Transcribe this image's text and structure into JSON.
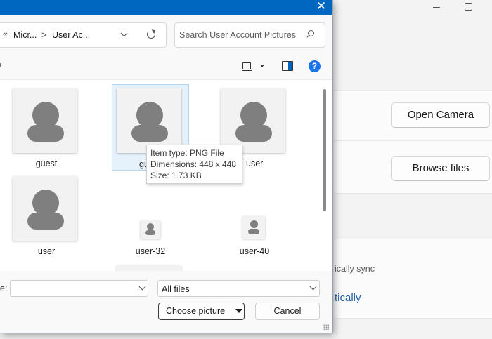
{
  "background": {
    "open_camera": "Open Camera",
    "browse_files": "Browse files",
    "sync_text": "ically sync",
    "auto_text": "tically"
  },
  "dialog": {
    "breadcrumb": {
      "back": "«",
      "part1": "Micr...",
      "sep": ">",
      "part2": "User Ac..."
    },
    "search": {
      "placeholder": "Search User Account Pictures"
    },
    "files": [
      {
        "name": "guest"
      },
      {
        "name": "gu"
      },
      {
        "name": "user"
      },
      {
        "name": "user"
      },
      {
        "name": "user-32"
      },
      {
        "name": "user-40"
      }
    ],
    "tooltip": {
      "type": "Item type: PNG File",
      "dimensions": "Dimensions: 448 x 448",
      "size": "Size: 1.73 KB"
    },
    "file_name_label": "e:",
    "file_name_value": "",
    "file_type": "All files",
    "choose_button": "Choose picture",
    "cancel_button": "Cancel",
    "help_label": "?",
    "close_label": "✕"
  }
}
